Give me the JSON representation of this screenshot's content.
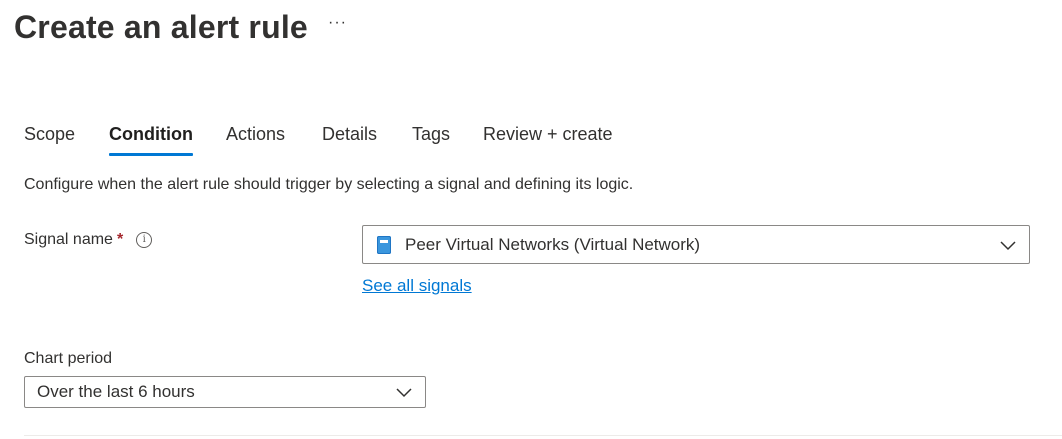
{
  "header": {
    "title": "Create an alert rule",
    "more_label": "···"
  },
  "tabs": [
    {
      "label": "Scope",
      "active": false
    },
    {
      "label": "Condition",
      "active": true
    },
    {
      "label": "Actions",
      "active": false
    },
    {
      "label": "Details",
      "active": false
    },
    {
      "label": "Tags",
      "active": false
    },
    {
      "label": "Review + create",
      "active": false
    }
  ],
  "condition": {
    "description": "Configure when the alert rule should trigger by selecting a signal and defining its logic.",
    "signal_label": "Signal name",
    "required_mark": "*",
    "info_icon": "i",
    "signal_value": "Peer Virtual Networks (Virtual Network)",
    "see_all_link": "See all signals",
    "chart_period_label": "Chart period",
    "chart_period_value": "Over the last 6 hours"
  },
  "colors": {
    "accent": "#0078d4",
    "required": "#a4262c",
    "text": "#323130"
  }
}
